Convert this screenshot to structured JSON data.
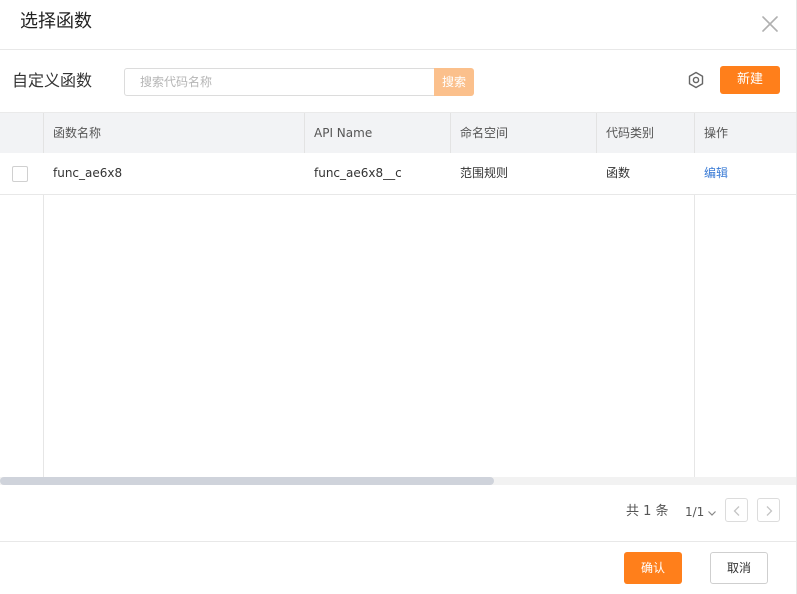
{
  "dialog": {
    "title": "选择函数",
    "close_icon": "close-icon"
  },
  "toolbar": {
    "section_title": "自定义函数",
    "search_placeholder": "搜索代码名称",
    "search_value": "",
    "search_button": "搜索",
    "settings_icon": "hexagon-gear-icon",
    "new_button": "新建"
  },
  "table": {
    "columns": [
      "函数名称",
      "API Name",
      "命名空间",
      "代码类别",
      "操作"
    ],
    "rows": [
      {
        "checked": false,
        "name": "func_ae6x8",
        "api_name": "func_ae6x8__c",
        "namespace": "范围规则",
        "category": "函数",
        "action": "编辑"
      }
    ]
  },
  "pagination": {
    "total": "共 1 条",
    "page": "1/1",
    "prev_icon": "chevron-left-icon",
    "next_icon": "chevron-right-icon"
  },
  "footer": {
    "confirm": "确认",
    "cancel": "取消"
  },
  "colors": {
    "accent": "#ff7f1b",
    "accent_light": "#fbc08c",
    "link": "#3a7bd5",
    "header_bg": "#f2f3f5"
  }
}
